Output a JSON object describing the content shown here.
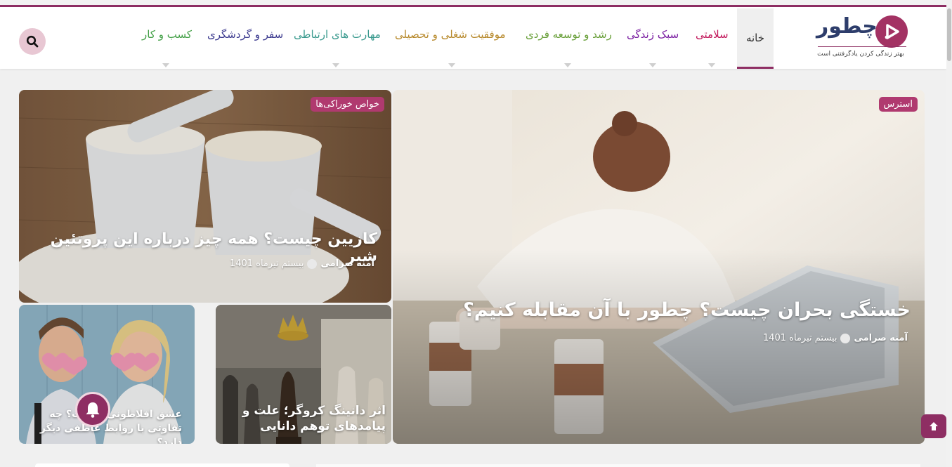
{
  "brand": {
    "name": "چطور",
    "tagline": "بهتر زندگی کردن یادگرفتنی است",
    "accent_color": "#8e2e63",
    "logo_color": "#a33263"
  },
  "nav": {
    "home": "خانه",
    "items": [
      {
        "label": "سلامتی",
        "color": "#c2185b"
      },
      {
        "label": "سبک زندگی",
        "color": "#7b1fa2"
      },
      {
        "label": "رشد و توسعه فردی",
        "color": "#689f38"
      },
      {
        "label": "موفقیت شغلی و تحصیلی",
        "color": "#b7892b"
      },
      {
        "label": "مهارت های ارتباطی",
        "color": "#3a9a8e"
      },
      {
        "label": "سفر و گردشگری",
        "color": "#3c3a8f"
      },
      {
        "label": "کسب و کار",
        "color": "#43a047"
      }
    ],
    "search_icon": "search-icon"
  },
  "featured": {
    "category": "استرس",
    "title": "خستگی بحران چیست؟ چطور با آن مقابله کنیم؟",
    "author": "آمنه صرامی",
    "date": "بیستم تیرماه 1401"
  },
  "post_casein": {
    "category": "خواص خوراکی‌ها",
    "title": "کازیین چیست؟ همه چیز درباره این پروتئین شیر",
    "author": "آمنه صرامی",
    "date": "بیستم تیرماه 1401"
  },
  "post_chess": {
    "title": "اثر دانینگ کروگر؛ علت و پیامدهای توهم دانایی"
  },
  "post_love": {
    "title": "عشق افلاطونی چیست؟ چه تفاوتی با روابط عاطفی دیگر دارد؟"
  },
  "widgets": {
    "notification_icon": "bell-icon",
    "back_to_top_icon": "arrow-up-icon"
  }
}
